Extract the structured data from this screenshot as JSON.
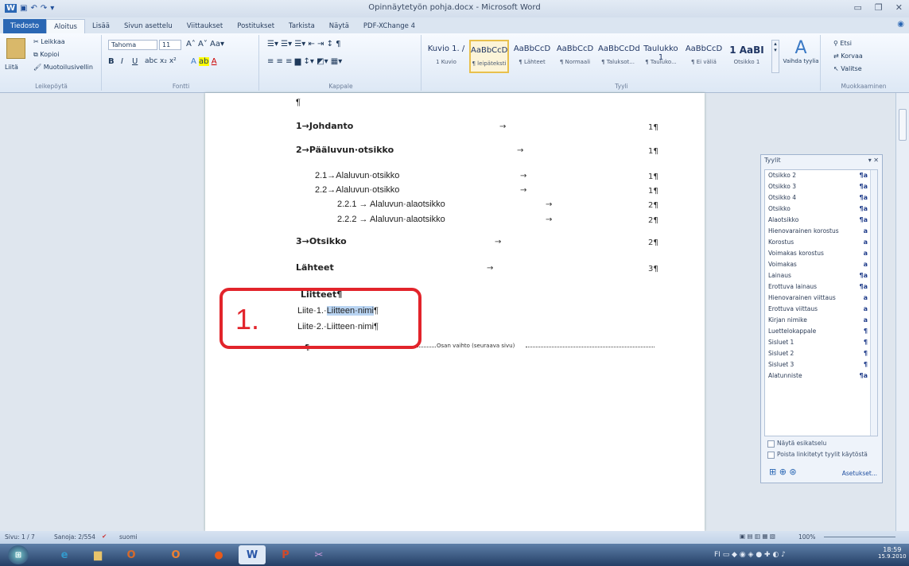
{
  "window": {
    "title": "Opinnäytetyön pohja.docx - Microsoft Word"
  },
  "tabs": [
    "Tiedosto",
    "Aloitus",
    "Lisää",
    "Sivun asettelu",
    "Viittaukset",
    "Postitukset",
    "Tarkista",
    "Näytä",
    "PDF-XChange 4"
  ],
  "ribbon": {
    "clipboard": {
      "paste": "Liitä",
      "cut": "Leikkaa",
      "copy": "Kopioi",
      "format_painter": "Muotoilusivellin",
      "label": "Leikepöytä"
    },
    "font": {
      "name": "Tahoma",
      "size": "11",
      "label": "Fontti"
    },
    "paragraph": {
      "label": "Kappale"
    },
    "styles": {
      "label": "Tyyli",
      "items": [
        {
          "preview": "Kuvio 1. /",
          "name": "1 Kuvio"
        },
        {
          "preview": "AaBbCcD",
          "name": "¶ leipäteksti"
        },
        {
          "preview": "AaBbCcD",
          "name": "¶ Lähteet"
        },
        {
          "preview": "AaBbCcD",
          "name": "¶ Normaali"
        },
        {
          "preview": "AaBbCcDd",
          "name": "¶ Taluksot..."
        },
        {
          "preview": "Taulukko 1",
          "name": "¶ Tauluko..."
        },
        {
          "preview": "AaBbCcD",
          "name": "¶ Ei väliä"
        },
        {
          "preview": "1 AaBI",
          "name": "Otsikko 1"
        }
      ],
      "change": "Vaihda tyylia"
    },
    "editing": {
      "find": "Etsi",
      "replace": "Korvaa",
      "select": "Valitse",
      "label": "Muokkaaminen"
    }
  },
  "document": {
    "pilcrow": "¶",
    "toc": [
      {
        "text": "1→Johdanto",
        "page": "1¶"
      },
      {
        "text": "2→Pääluvun·otsikko",
        "page": "1¶"
      },
      {
        "text": "2.1→Alaluvun·otsikko",
        "page": "1¶"
      },
      {
        "text": "2.2→Alaluvun·otsikko",
        "page": "1¶"
      },
      {
        "text": "2.2.1 → Alaluvun·alaotsikko",
        "page": "2¶"
      },
      {
        "text": "2.2.2 → Alaluvun·alaotsikko",
        "page": "2¶"
      },
      {
        "text": "3→Otsikko",
        "page": "2¶"
      },
      {
        "text": "Lähteet",
        "page": "3¶"
      }
    ],
    "liitteet_heading": "Liitteet¶",
    "liite1_prefix": "Liite·1.·",
    "liite1_name": "Liitteen·nimi",
    "liite1_end": "¶",
    "liite2": "Liite·2.·Liitteen·nimi¶",
    "section_break": "Osan vaihto (seuraava sivu)",
    "callout_number": "1."
  },
  "styles_pane": {
    "title": "Tyylit",
    "items": [
      {
        "name": "Otsikko 2",
        "icon": "¶a"
      },
      {
        "name": "Otsikko 3",
        "icon": "¶a"
      },
      {
        "name": "Otsikko 4",
        "icon": "¶a"
      },
      {
        "name": "Otsikko",
        "icon": "¶a"
      },
      {
        "name": "Alaotsikko",
        "icon": "¶a"
      },
      {
        "name": "Hienovarainen korostus",
        "icon": "a"
      },
      {
        "name": "Korostus",
        "icon": "a"
      },
      {
        "name": "Voimakas korostus",
        "icon": "a"
      },
      {
        "name": "Voimakas",
        "icon": "a"
      },
      {
        "name": "Lainaus",
        "icon": "¶a"
      },
      {
        "name": "Erottuva lainaus",
        "icon": "¶a"
      },
      {
        "name": "Hienovarainen viittaus",
        "icon": "a"
      },
      {
        "name": "Erottuva viittaus",
        "icon": "a"
      },
      {
        "name": "Kirjan nimike",
        "icon": "a"
      },
      {
        "name": "Luettelokappale",
        "icon": "¶"
      },
      {
        "name": "Sisluet 1",
        "icon": "¶"
      },
      {
        "name": "Sisluet 2",
        "icon": "¶"
      },
      {
        "name": "Sisluet 3",
        "icon": "¶"
      },
      {
        "name": "Alatunniste",
        "icon": "¶a"
      }
    ],
    "show_preview": "Näytä esikatselu",
    "disable_linked": "Poista linkitetyt tyylit käytöstä",
    "options": "Asetukset..."
  },
  "status": {
    "page": "Sivu: 1 / 7",
    "words": "Sanoja: 2/554",
    "language": "suomi",
    "zoom": "100%"
  },
  "clock": {
    "time": "18:59",
    "date": "15.9.2010"
  }
}
